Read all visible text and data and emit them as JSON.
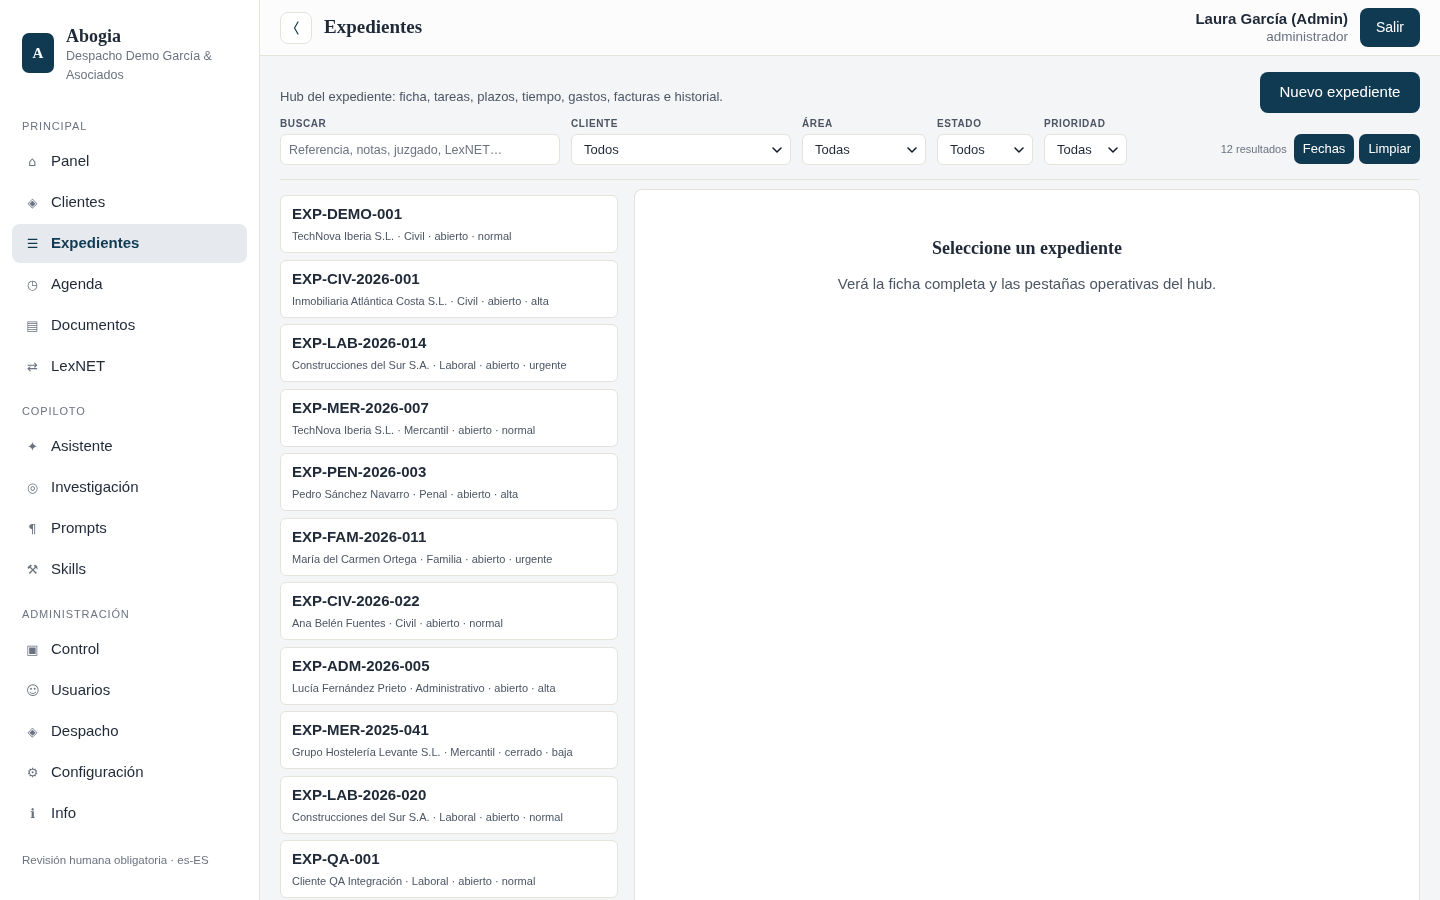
{
  "sidebar": {
    "logo": "A",
    "brand": "Abogia",
    "firm": "Despacho Demo García & Asociados",
    "sections": [
      {
        "title": "PRINCIPAL",
        "items": [
          {
            "icon": "⌂",
            "label": "Panel",
            "selected": false
          },
          {
            "icon": "◈",
            "label": "Clientes",
            "selected": false
          },
          {
            "icon": "☰",
            "label": "Expedientes",
            "selected": true
          },
          {
            "icon": "◷",
            "label": "Agenda",
            "selected": false
          },
          {
            "icon": "▤",
            "label": "Documentos",
            "selected": false
          },
          {
            "icon": "⇄",
            "label": "LexNET",
            "selected": false
          }
        ]
      },
      {
        "title": "COPILOTO",
        "items": [
          {
            "icon": "✦",
            "label": "Asistente",
            "selected": false
          },
          {
            "icon": "◎",
            "label": "Investigación",
            "selected": false
          },
          {
            "icon": "¶",
            "label": "Prompts",
            "selected": false
          },
          {
            "icon": "⚒",
            "label": "Skills",
            "selected": false
          }
        ]
      },
      {
        "title": "ADMINISTRACIÓN",
        "items": [
          {
            "icon": "▣",
            "label": "Control",
            "selected": false
          },
          {
            "icon": "☺",
            "label": "Usuarios",
            "selected": false
          },
          {
            "icon": "◈",
            "label": "Despacho",
            "selected": false
          },
          {
            "icon": "⚙",
            "label": "Configuración",
            "selected": false
          },
          {
            "icon": "ℹ",
            "label": "Info",
            "selected": false
          }
        ]
      }
    ],
    "footer": "Revisión humana obligatoria · es-ES"
  },
  "header": {
    "title": "Expedientes",
    "user": {
      "name": "Laura García (Admin)",
      "role": "administrador"
    },
    "logout": "Salir"
  },
  "toolbar": {
    "description": "Hub del expediente: ficha, tareas, plazos, tiempo, gastos, facturas e historial.",
    "new_button": "Nuevo expediente"
  },
  "filters": {
    "search": {
      "label": "BUSCAR",
      "placeholder": "Referencia, notas, juzgado, LexNET…"
    },
    "selects": [
      {
        "label": "CLIENTE",
        "value": "Todos"
      },
      {
        "label": "ÁREA",
        "value": "Todas"
      },
      {
        "label": "ESTADO",
        "value": "Todos"
      },
      {
        "label": "PRIORIDAD",
        "value": "Todas"
      }
    ],
    "results": "12 resultados",
    "buttons": [
      "Fechas",
      "Limpiar"
    ]
  },
  "cases": [
    {
      "reference": "EXP-DEMO-001",
      "meta": "TechNova Iberia S.L. · Civil · abierto · normal",
      "selected": false
    },
    {
      "reference": "EXP-CIV-2026-001",
      "meta": "Inmobiliaria Atlántica Costa S.L. · Civil · abierto · alta",
      "selected": false
    },
    {
      "reference": "EXP-LAB-2026-014",
      "meta": "Construcciones del Sur S.A. · Laboral · abierto · urgente",
      "selected": false
    },
    {
      "reference": "EXP-MER-2026-007",
      "meta": "TechNova Iberia S.L. · Mercantil · abierto · normal",
      "selected": false
    },
    {
      "reference": "EXP-PEN-2026-003",
      "meta": "Pedro Sánchez Navarro · Penal · abierto · alta",
      "selected": false
    },
    {
      "reference": "EXP-FAM-2026-011",
      "meta": "María del Carmen Ortega · Familia · abierto · urgente",
      "selected": false
    },
    {
      "reference": "EXP-CIV-2026-022",
      "meta": "Ana Belén Fuentes · Civil · abierto · normal",
      "selected": false
    },
    {
      "reference": "EXP-ADM-2026-005",
      "meta": "Lucía Fernández Prieto · Administrativo · abierto · alta",
      "selected": false
    },
    {
      "reference": "EXP-MER-2025-041",
      "meta": "Grupo Hostelería Levante S.L. · Mercantil · cerrado · baja",
      "selected": false
    },
    {
      "reference": "EXP-LAB-2026-020",
      "meta": "Construcciones del Sur S.A. · Laboral · abierto · normal",
      "selected": false
    },
    {
      "reference": "EXP-QA-001",
      "meta": "Cliente QA Integración · Laboral · abierto · normal",
      "selected": false
    }
  ],
  "detail": {
    "title": "Seleccione un expediente",
    "text": "Verá la ficha completa y las pestañas operativas del hub."
  }
}
